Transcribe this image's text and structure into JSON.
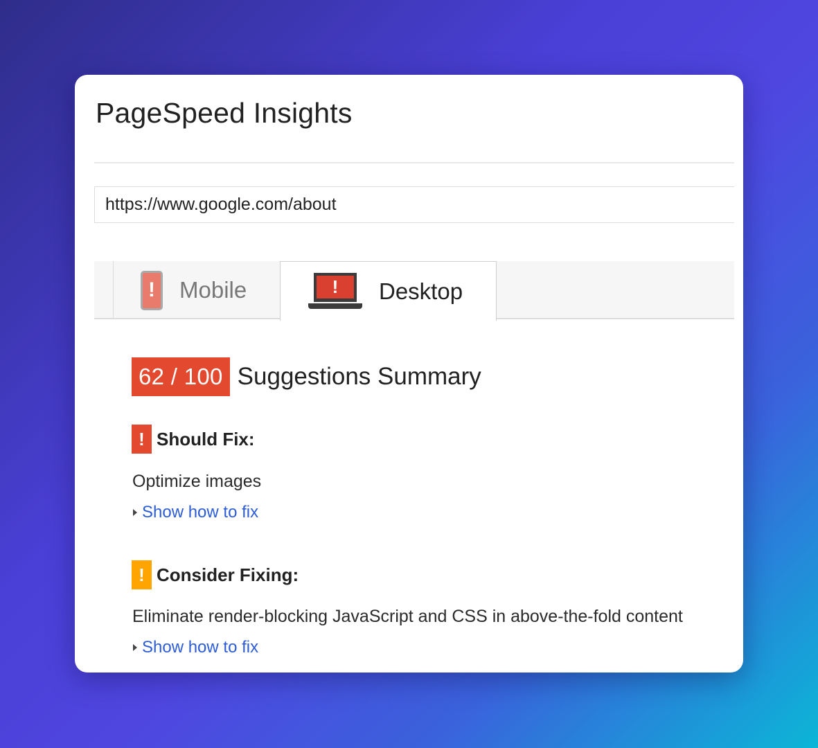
{
  "app": {
    "title": "PageSpeed Insights"
  },
  "url_input": {
    "value": "https://www.google.com/about"
  },
  "tabs": [
    {
      "label": "Mobile",
      "active": false,
      "icon": "mobile-warning-icon"
    },
    {
      "label": "Desktop",
      "active": true,
      "icon": "laptop-warning-icon"
    }
  ],
  "summary": {
    "score": "62 / 100",
    "title": "Suggestions Summary",
    "score_color": "#e2492f"
  },
  "sections": [
    {
      "icon_text": "!",
      "icon_color": "#e2492f",
      "label": "Should Fix:",
      "rule": "Optimize images",
      "link": "Show how to fix"
    },
    {
      "icon_text": "!",
      "icon_color": "#ffa400",
      "label": "Consider Fixing:",
      "rule": "Eliminate render-blocking JavaScript and CSS in above-the-fold content",
      "link": "Show how to fix"
    }
  ],
  "icons": {
    "alert_glyph": "!"
  }
}
